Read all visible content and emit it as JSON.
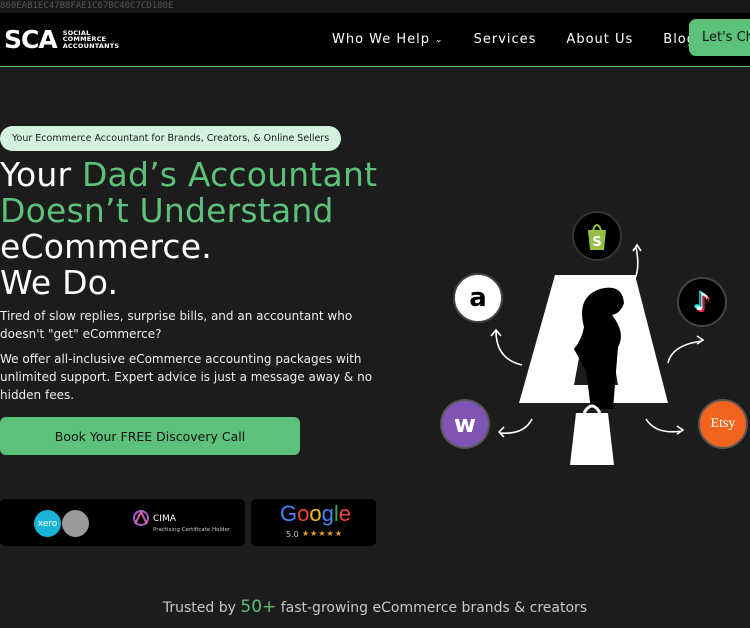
{
  "top_strip": {
    "text": "860EAB1EC47B8FAE1C67BC40C7CD180E"
  },
  "brand": {
    "mark": "SCA",
    "text_lines": [
      "SOCIAL",
      "COMMERCE",
      "ACCOUNTANTS"
    ]
  },
  "nav": {
    "items": [
      {
        "label": "Who We Help",
        "dropdown": true
      },
      {
        "label": "Services"
      },
      {
        "label": "About Us"
      },
      {
        "label": "Blog"
      }
    ],
    "cta_label": "Let's Chat"
  },
  "hero": {
    "pill": "Your Ecommerce Accountant for Brands, Creators, & Online Sellers",
    "headline": {
      "w1": "Your ",
      "g1": "Dad’s Accountant",
      "g2": "Doesn’t Understand",
      "l3": "eCommerce.",
      "l4": "We Do."
    },
    "para1": "Tired of slow replies, surprise bills, and an accountant who doesn't \"get\" eCommerce?",
    "para2": "We offer all-inclusive eCommerce accounting packages with unlimited support. Expert advice is just a message away & no hidden fees.",
    "cta_label": "Book Your FREE Discovery Call"
  },
  "badges": {
    "xero": "xero",
    "cima_name": "CIMA",
    "cima_sub": "Practising Certificate Holder",
    "google_word": "Google",
    "google_rating": "5.0",
    "google_stars": "★★★★★"
  },
  "trusted": {
    "prefix": "Trusted by ",
    "number": "50+",
    "suffix": " fast-growing eCommerce brands & creators"
  },
  "platforms": {
    "etsy": "Etsy",
    "amazon": "a",
    "woo": "w",
    "tiktok": "♪"
  },
  "colors": {
    "accent": "#5cc27a",
    "background": "#1c1c1c",
    "header": "#000000"
  }
}
